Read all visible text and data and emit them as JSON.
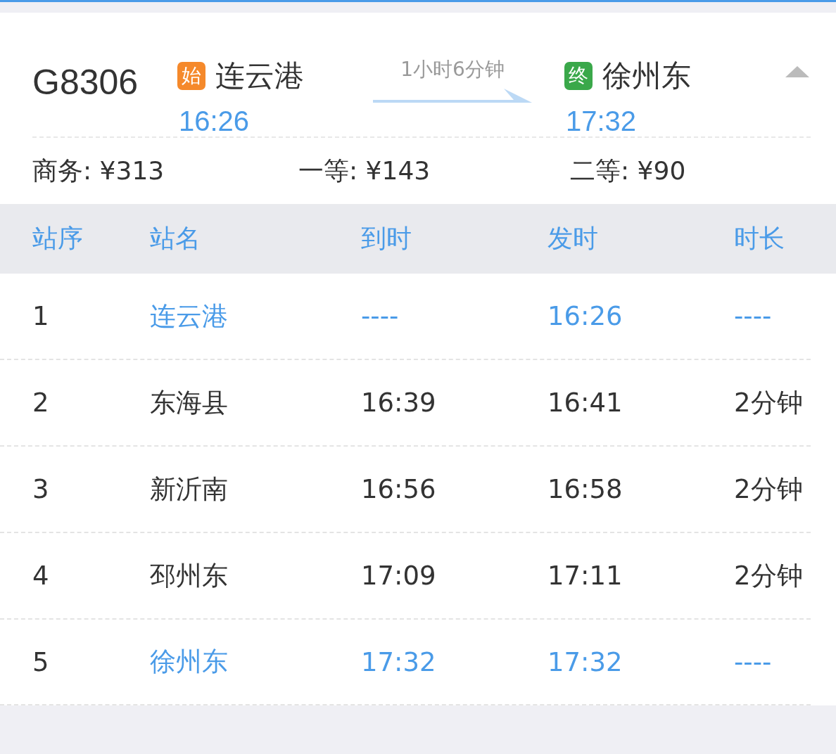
{
  "train": {
    "number": "G8306",
    "duration": "1小时6分钟",
    "expanded": true,
    "origin": {
      "badge": "始",
      "color": "#f5892b",
      "station": "连云港",
      "time": "16:26"
    },
    "destination": {
      "badge": "终",
      "color": "#3aa84a",
      "station": "徐州东",
      "time": "17:32"
    }
  },
  "prices": [
    "商务: ¥313",
    "一等: ¥143",
    "二等: ¥90"
  ],
  "table": {
    "columns": [
      "站序",
      "站名",
      "到时",
      "发时",
      "时长"
    ],
    "rows": [
      {
        "cells": [
          "1",
          "连云港",
          "----",
          "16:26",
          "----"
        ],
        "highlighted": true
      },
      {
        "cells": [
          "2",
          "东海县",
          "16:39",
          "16:41",
          "2分钟"
        ],
        "highlighted": false
      },
      {
        "cells": [
          "3",
          "新沂南",
          "16:56",
          "16:58",
          "2分钟"
        ],
        "highlighted": false
      },
      {
        "cells": [
          "4",
          "邳州东",
          "17:09",
          "17:11",
          "2分钟"
        ],
        "highlighted": false
      },
      {
        "cells": [
          "5",
          "徐州东",
          "17:32",
          "17:32",
          "----"
        ],
        "highlighted": true
      }
    ]
  }
}
